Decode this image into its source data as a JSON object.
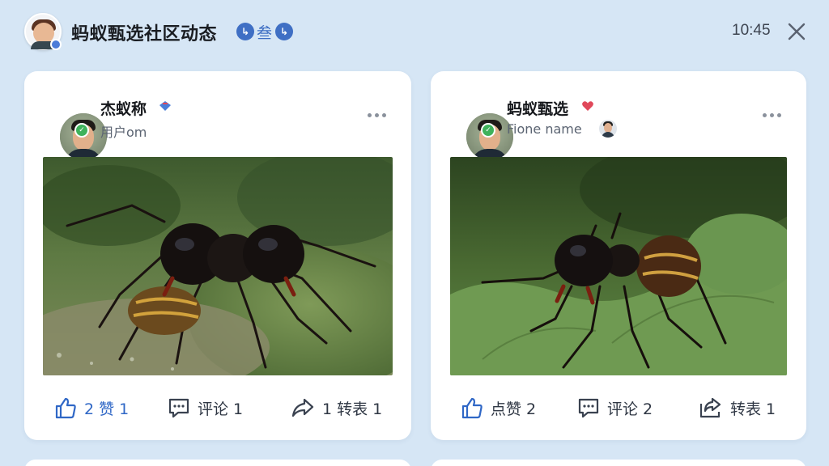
{
  "header": {
    "title": "蚂蚁甄选社区动态",
    "badge_left": "↳",
    "badge_text": "叁",
    "badge_right": "↳",
    "time": "10:45"
  },
  "icons": {
    "me_avatar": "user-avatar-icon",
    "close": "close-icon",
    "more": "more-dots-icon",
    "like": "thumbs-up-icon",
    "comment": "comment-bubble-icon",
    "share": "share-arrow-icon"
  },
  "colors": {
    "background": "#d6e6f5",
    "card": "#ffffff",
    "accent_blue": "#2f67c6",
    "verify_green": "#3fb25b",
    "heart_red": "#e0485a"
  },
  "posts": [
    {
      "author": "杰蚁称",
      "subtitle": "用户om",
      "image_alt": "",
      "like_label": "2 赞 1",
      "comment_label": "评论 1",
      "share_label": "1 转表 1"
    },
    {
      "author": "蚂蚁甄选",
      "subtitle": "Fione name",
      "image_alt": "",
      "like_label": "点赞 2",
      "comment_label": "评论 2",
      "share_label": "转表 1"
    }
  ]
}
